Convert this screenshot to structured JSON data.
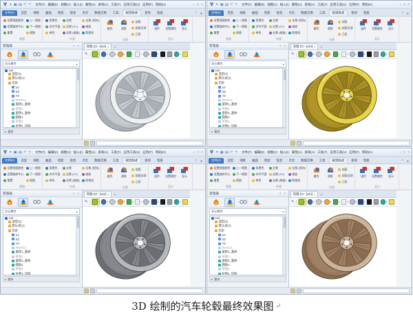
{
  "caption": {
    "text": "3D 绘制的汽车轮毂最终效果图",
    "mark": "↵"
  },
  "window": {
    "app_icon": "zw3d-logo",
    "quick_access": [
      "new",
      "save",
      "open",
      "undo",
      "redo"
    ],
    "menu": [
      "文件(F)",
      "编辑(E)",
      "视图(V)",
      "插入(I)",
      "属性(A)",
      "查询(A)",
      "工具(T)",
      "应用工具(U)",
      "应用(P)",
      "帮助(H)"
    ],
    "window_controls": [
      "–",
      "□",
      "×"
    ],
    "ribbon_tabs": [
      {
        "label": "文件(F)",
        "state": "accent"
      },
      {
        "label": "造型",
        "state": ""
      },
      {
        "label": "线框",
        "state": ""
      },
      {
        "label": "曲面",
        "state": ""
      },
      {
        "label": "装配",
        "state": ""
      },
      {
        "label": "钣金",
        "state": ""
      },
      {
        "label": "点云",
        "state": ""
      },
      {
        "label": "数据交换",
        "state": ""
      },
      {
        "label": "工具",
        "state": ""
      },
      {
        "label": "视觉样式",
        "state": "selected"
      },
      {
        "label": "查询",
        "state": ""
      },
      {
        "label": "电极",
        "state": ""
      }
    ],
    "ribbon_tab_extras": [
      "^",
      "●"
    ],
    "ribbon_groups": [
      {
        "label": "视图",
        "cols": [
          [
            "设置视图颜色",
            "设置旋转中心",
            "重置"
          ],
          [
            "上一视图",
            "下一视图",
            "视图"
          ]
        ]
      },
      {
        "label": "外观",
        "cols": [
          [
            "背景色",
            "对齐平面",
            "单色"
          ],
          [
            "全景",
            "全景 (XY)",
            "全景 (缩放)"
          ],
          [
            "全景 (视向)",
            "缩放",
            "照相机"
          ]
        ]
      },
      {
        "label": "光源",
        "big": [
          "着色",
          "消隐"
        ],
        "col": [
          "剖面",
          "剖面全部",
          "凸显"
        ]
      },
      {
        "label": "显示",
        "big": [
          "组件",
          "设置属性",
          "显示"
        ]
      }
    ],
    "panel": {
      "title": "管理器",
      "header_icons": "⊹ ×",
      "tabs": [
        "history-manager",
        "solid-manager",
        "visual-manager",
        "layer-manager"
      ],
      "view_mode": "显示属性",
      "root": "s44",
      "tree": [
        {
          "label": "造型(1)",
          "type": "folder",
          "indent": 1
        },
        {
          "label": "默认式(1)",
          "type": "folder",
          "indent": 1
        },
        {
          "label": "历史",
          "type": "folder",
          "indent": 1
        },
        {
          "label": "XY",
          "type": "plane",
          "indent": 2
        },
        {
          "label": "XZ",
          "type": "plane",
          "indent": 2
        },
        {
          "label": "YZ",
          "type": "plane",
          "indent": 2
        },
        {
          "label": "Sketch1",
          "type": "sketch-dim",
          "indent": 2
        },
        {
          "label": "旋转1_基体",
          "type": "feature",
          "indent": 2
        },
        {
          "label": "草图2",
          "type": "sketch-dim",
          "indent": 2
        },
        {
          "label": "旋转2_基体",
          "type": "feature",
          "indent": 2
        },
        {
          "label": "圆角1",
          "type": "feature",
          "indent": 2
        },
        {
          "label": "草图3",
          "type": "sketch-dim",
          "indent": 2
        },
        {
          "label": "拉伸1_切除",
          "type": "feature",
          "indent": 2
        },
        {
          "label": "阵列1",
          "type": "feature-dim",
          "indent": 2
        }
      ],
      "footer": "重放"
    },
    "doc_tab": "轮毂.Z3 - [s44]",
    "doc_tab_close": "×",
    "doc_tab_plus": "+",
    "da_icons": [
      {
        "name": "shaded-display",
        "color": "#8cc63f",
        "caret": true,
        "active": true,
        "square": true
      },
      {
        "name": "render-display",
        "color": "#3d6fb5",
        "caret": true
      },
      {
        "name": "hidden-line-display",
        "color": "#c8ccd0",
        "caret": true
      },
      {
        "name": "wireframe-display",
        "color": "#e8a93a",
        "caret": true
      },
      {
        "name": "section-view",
        "color": "#4aa64a",
        "caret": true,
        "square": true
      },
      {
        "name": "zoom-window",
        "color": "#eef2f6",
        "caret": true,
        "square": true
      },
      {
        "name": "annotation",
        "color": "#b8bfd0",
        "caret": true
      },
      {
        "name": "view-cube",
        "color": "#2b4a7a",
        "caret": true,
        "square": true
      },
      {
        "name": "background-black",
        "color": "#1a1a1a",
        "caret": false,
        "square": true
      },
      {
        "name": "background-gray",
        "color": "#9aa0a6",
        "caret": false,
        "square": true
      },
      {
        "name": "globe-view",
        "color": "#2aa8a0",
        "caret": true
      },
      {
        "name": "light-toggle",
        "color": "#e8d84a",
        "caret": false,
        "square": true
      }
    ]
  },
  "windows": [
    {
      "name": "silver-wheel",
      "wheel": {
        "base": "#c6cacf",
        "mid": "#a9afb6",
        "dark": "#7d848c",
        "light": "#eef0f2",
        "line": "#5f666e"
      }
    },
    {
      "name": "gold-wheel",
      "wheel": {
        "base": "#b09428",
        "mid": "#937d1e",
        "dark": "#645211",
        "light": "#e6d44c",
        "line": "#493c0c"
      }
    },
    {
      "name": "gunmetal-wheel",
      "wheel": {
        "base": "#84878b",
        "mid": "#6b6e72",
        "dark": "#46484c",
        "light": "#b5b8bc",
        "line": "#323438"
      }
    },
    {
      "name": "bronze-wheel",
      "wheel": {
        "base": "#a08165",
        "mid": "#8a6c50",
        "dark": "#5c4430",
        "light": "#ccb49b",
        "line": "#40301f"
      }
    }
  ]
}
